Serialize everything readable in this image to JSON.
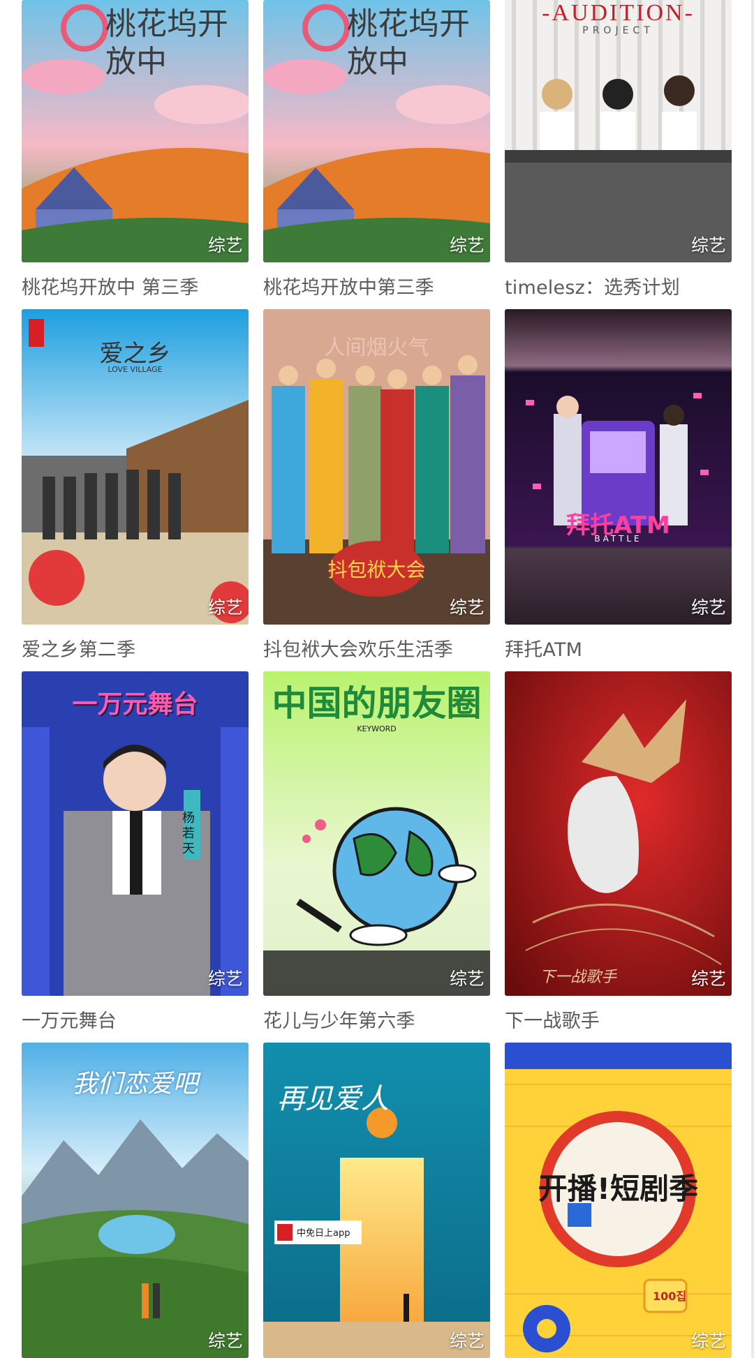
{
  "grid": {
    "items": [
      {
        "title": "桃花坞开放中 第三季",
        "badge": "综艺",
        "poster_text": "桃花坞开放中",
        "poster_sub": "",
        "poster_theme": "peach"
      },
      {
        "title": "桃花坞开放中第三季",
        "badge": "综艺",
        "poster_text": "桃花坞开放中",
        "poster_sub": "",
        "poster_theme": "peach"
      },
      {
        "title": "timelesz：选秀计划",
        "badge": "综艺",
        "poster_text": "-AUDITION-",
        "poster_sub": "PROJECT",
        "poster_theme": "audition"
      },
      {
        "title": "爱之乡第二季",
        "badge": "综艺",
        "poster_text": "爱之乡",
        "poster_sub": "LOVE VILLAGE",
        "poster_theme": "village"
      },
      {
        "title": "抖包袱大会欢乐生活季",
        "badge": "综艺",
        "poster_text": "抖包袱大会",
        "poster_sub": "人间烟火气",
        "poster_theme": "comedy"
      },
      {
        "title": "拜托ATM",
        "badge": "综艺",
        "poster_text": "拜托ATM",
        "poster_sub": "BATTLE",
        "poster_theme": "atm"
      },
      {
        "title": "一万元舞台",
        "badge": "综艺",
        "poster_text": "一万元舞台",
        "poster_sub": "杨若天",
        "poster_theme": "stage"
      },
      {
        "title": "花儿与少年第六季",
        "badge": "综艺",
        "poster_text": "中国的朋友圈",
        "poster_sub": "KEYWORD",
        "poster_theme": "globe"
      },
      {
        "title": "下一战歌手",
        "badge": "综艺",
        "poster_text": "下一战歌手",
        "poster_sub": "",
        "poster_theme": "singer"
      },
      {
        "title": "",
        "badge": "综艺",
        "poster_text": "我们恋爱吧",
        "poster_sub": "",
        "poster_theme": "mountain"
      },
      {
        "title": "",
        "badge": "综艺",
        "poster_text": "再见爱人",
        "poster_sub": "中免日上app",
        "poster_theme": "door"
      },
      {
        "title": "",
        "badge": "综艺",
        "poster_text": "开播!短剧季",
        "poster_sub": "100집",
        "poster_theme": "drama"
      }
    ]
  },
  "colors": {
    "title_text": "#5b5b5b",
    "badge_text": "#ffffff",
    "background": "#ffffff"
  }
}
